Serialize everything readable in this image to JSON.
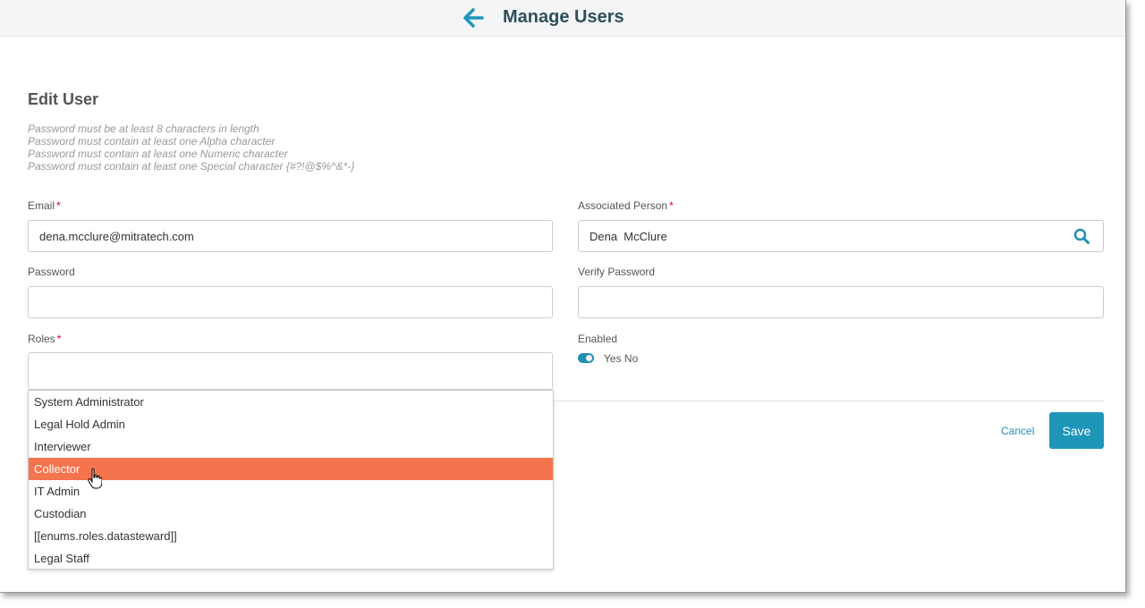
{
  "header": {
    "title": "Manage Users"
  },
  "form": {
    "title": "Edit User",
    "rules": [
      "Password must be at least 8 characters in length",
      "Password must contain at least one Alpha character",
      "Password must contain at least one Numeric character",
      "Password must contain at least one Special character {#?!@$%^&*-}"
    ],
    "email": {
      "label": "Email",
      "required": "*",
      "value": "dena.mcclure@mitratech.com"
    },
    "associated_person": {
      "label": "Associated Person",
      "required": "*",
      "value": "Dena  McClure"
    },
    "password": {
      "label": "Password",
      "value": ""
    },
    "verify_password": {
      "label": "Verify Password",
      "value": ""
    },
    "roles": {
      "label": "Roles",
      "required": "*",
      "value": "",
      "options": [
        "System Administrator",
        "Legal Hold Admin",
        "Interviewer",
        "Collector",
        "IT Admin",
        "Custodian",
        "[[enums.roles.datasteward]]",
        "Legal Staff"
      ],
      "highlighted": "Collector"
    },
    "enabled": {
      "label": "Enabled",
      "toggle_text": "Yes No",
      "state": "on"
    }
  },
  "actions": {
    "cancel_label": "Cancel",
    "save_label": "Save"
  },
  "colors": {
    "accent": "#1f95b8",
    "highlight": "#f4744d",
    "required": "#d0021b"
  }
}
